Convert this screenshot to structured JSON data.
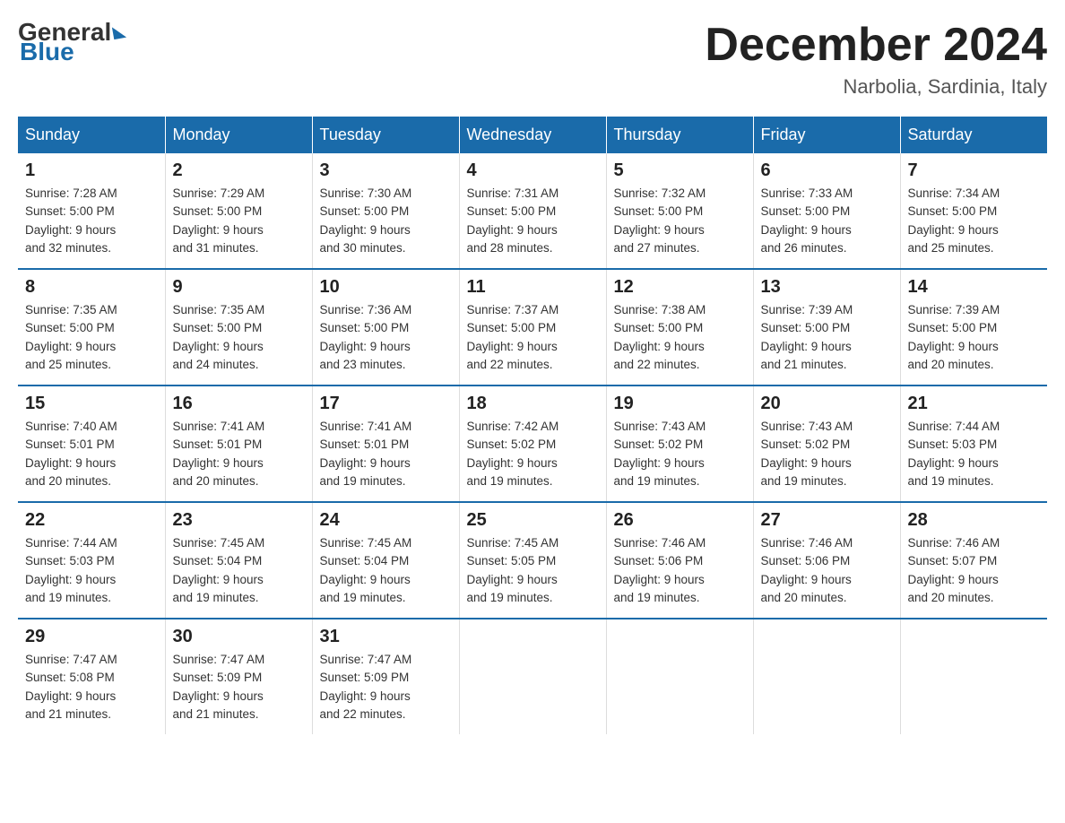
{
  "logo": {
    "general": "General",
    "blue": "Blue"
  },
  "title": "December 2024",
  "location": "Narbolia, Sardinia, Italy",
  "days_of_week": [
    "Sunday",
    "Monday",
    "Tuesday",
    "Wednesday",
    "Thursday",
    "Friday",
    "Saturday"
  ],
  "weeks": [
    [
      {
        "day": "1",
        "sunrise": "7:28 AM",
        "sunset": "5:00 PM",
        "daylight": "9 hours and 32 minutes."
      },
      {
        "day": "2",
        "sunrise": "7:29 AM",
        "sunset": "5:00 PM",
        "daylight": "9 hours and 31 minutes."
      },
      {
        "day": "3",
        "sunrise": "7:30 AM",
        "sunset": "5:00 PM",
        "daylight": "9 hours and 30 minutes."
      },
      {
        "day": "4",
        "sunrise": "7:31 AM",
        "sunset": "5:00 PM",
        "daylight": "9 hours and 28 minutes."
      },
      {
        "day": "5",
        "sunrise": "7:32 AM",
        "sunset": "5:00 PM",
        "daylight": "9 hours and 27 minutes."
      },
      {
        "day": "6",
        "sunrise": "7:33 AM",
        "sunset": "5:00 PM",
        "daylight": "9 hours and 26 minutes."
      },
      {
        "day": "7",
        "sunrise": "7:34 AM",
        "sunset": "5:00 PM",
        "daylight": "9 hours and 25 minutes."
      }
    ],
    [
      {
        "day": "8",
        "sunrise": "7:35 AM",
        "sunset": "5:00 PM",
        "daylight": "9 hours and 25 minutes."
      },
      {
        "day": "9",
        "sunrise": "7:35 AM",
        "sunset": "5:00 PM",
        "daylight": "9 hours and 24 minutes."
      },
      {
        "day": "10",
        "sunrise": "7:36 AM",
        "sunset": "5:00 PM",
        "daylight": "9 hours and 23 minutes."
      },
      {
        "day": "11",
        "sunrise": "7:37 AM",
        "sunset": "5:00 PM",
        "daylight": "9 hours and 22 minutes."
      },
      {
        "day": "12",
        "sunrise": "7:38 AM",
        "sunset": "5:00 PM",
        "daylight": "9 hours and 22 minutes."
      },
      {
        "day": "13",
        "sunrise": "7:39 AM",
        "sunset": "5:00 PM",
        "daylight": "9 hours and 21 minutes."
      },
      {
        "day": "14",
        "sunrise": "7:39 AM",
        "sunset": "5:00 PM",
        "daylight": "9 hours and 20 minutes."
      }
    ],
    [
      {
        "day": "15",
        "sunrise": "7:40 AM",
        "sunset": "5:01 PM",
        "daylight": "9 hours and 20 minutes."
      },
      {
        "day": "16",
        "sunrise": "7:41 AM",
        "sunset": "5:01 PM",
        "daylight": "9 hours and 20 minutes."
      },
      {
        "day": "17",
        "sunrise": "7:41 AM",
        "sunset": "5:01 PM",
        "daylight": "9 hours and 19 minutes."
      },
      {
        "day": "18",
        "sunrise": "7:42 AM",
        "sunset": "5:02 PM",
        "daylight": "9 hours and 19 minutes."
      },
      {
        "day": "19",
        "sunrise": "7:43 AM",
        "sunset": "5:02 PM",
        "daylight": "9 hours and 19 minutes."
      },
      {
        "day": "20",
        "sunrise": "7:43 AM",
        "sunset": "5:02 PM",
        "daylight": "9 hours and 19 minutes."
      },
      {
        "day": "21",
        "sunrise": "7:44 AM",
        "sunset": "5:03 PM",
        "daylight": "9 hours and 19 minutes."
      }
    ],
    [
      {
        "day": "22",
        "sunrise": "7:44 AM",
        "sunset": "5:03 PM",
        "daylight": "9 hours and 19 minutes."
      },
      {
        "day": "23",
        "sunrise": "7:45 AM",
        "sunset": "5:04 PM",
        "daylight": "9 hours and 19 minutes."
      },
      {
        "day": "24",
        "sunrise": "7:45 AM",
        "sunset": "5:04 PM",
        "daylight": "9 hours and 19 minutes."
      },
      {
        "day": "25",
        "sunrise": "7:45 AM",
        "sunset": "5:05 PM",
        "daylight": "9 hours and 19 minutes."
      },
      {
        "day": "26",
        "sunrise": "7:46 AM",
        "sunset": "5:06 PM",
        "daylight": "9 hours and 19 minutes."
      },
      {
        "day": "27",
        "sunrise": "7:46 AM",
        "sunset": "5:06 PM",
        "daylight": "9 hours and 20 minutes."
      },
      {
        "day": "28",
        "sunrise": "7:46 AM",
        "sunset": "5:07 PM",
        "daylight": "9 hours and 20 minutes."
      }
    ],
    [
      {
        "day": "29",
        "sunrise": "7:47 AM",
        "sunset": "5:08 PM",
        "daylight": "9 hours and 21 minutes."
      },
      {
        "day": "30",
        "sunrise": "7:47 AM",
        "sunset": "5:09 PM",
        "daylight": "9 hours and 21 minutes."
      },
      {
        "day": "31",
        "sunrise": "7:47 AM",
        "sunset": "5:09 PM",
        "daylight": "9 hours and 22 minutes."
      },
      null,
      null,
      null,
      null
    ]
  ],
  "labels": {
    "sunrise": "Sunrise:",
    "sunset": "Sunset:",
    "daylight": "Daylight:"
  }
}
